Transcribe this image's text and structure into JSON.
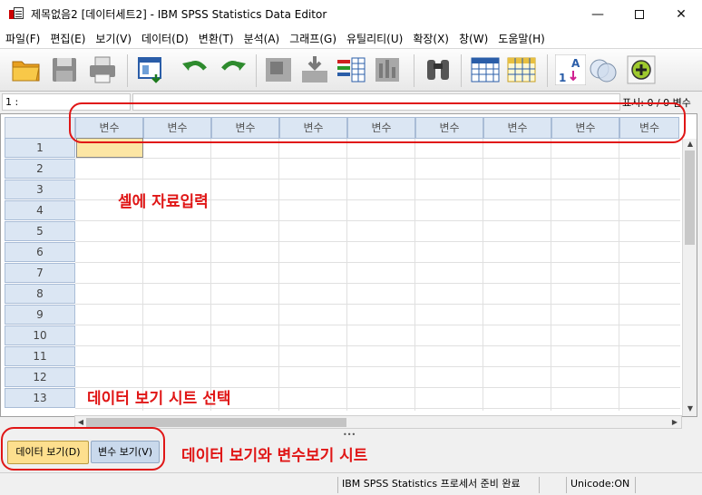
{
  "window": {
    "title": "제목없음2 [데이터세트2] - IBM SPSS Statistics Data Editor",
    "minimize_glyph": "—",
    "close_glyph": "✕"
  },
  "menu": [
    {
      "label": "파일(F)"
    },
    {
      "label": "편집(E)"
    },
    {
      "label": "보기(V)"
    },
    {
      "label": "데이터(D)"
    },
    {
      "label": "변환(T)"
    },
    {
      "label": "분석(A)"
    },
    {
      "label": "그래프(G)"
    },
    {
      "label": "유틸리티(U)"
    },
    {
      "label": "확장(X)"
    },
    {
      "label": "창(W)"
    },
    {
      "label": "도움말(H)"
    }
  ],
  "toolbar": {
    "icons": [
      "open-folder-icon",
      "save-icon",
      "print-icon",
      "dialog-recall-icon",
      "undo-icon",
      "redo-icon",
      "goto-case-icon",
      "goto-variable-icon",
      "variables-icon",
      "run-descriptive-icon",
      "find-icon",
      "insert-cases-icon",
      "insert-variable-icon",
      "value-labels-icon",
      "use-sets-icon",
      "add-icon"
    ]
  },
  "cell_editor": {
    "cell_ref": "1 :",
    "visible_count": "표시: 0 / 0 변수"
  },
  "grid": {
    "column_header": "변수",
    "columns": [
      "변수",
      "변수",
      "변수",
      "변수",
      "변수",
      "변수",
      "변수",
      "변수",
      "변수"
    ],
    "rows": [
      "1",
      "2",
      "3",
      "4",
      "5",
      "6",
      "7",
      "8",
      "9",
      "10",
      "11",
      "12",
      "13"
    ]
  },
  "tabs": {
    "data_view": "데이터 보기(D)",
    "variable_view": "변수 보기(V)"
  },
  "annotations": {
    "cell_input": "셀에 자료입력",
    "data_view_select": "데이터 보기 시트 선택",
    "sheets": "데이터 보기와 변수보기 시트"
  },
  "status": {
    "processor": "IBM SPSS Statistics 프로세서 준비 완료",
    "unicode": "Unicode:ON"
  },
  "colors": {
    "annotation": "#e01616",
    "selected_cell": "#fce6a4",
    "header": "#dbe6f3",
    "data_tab": "#fddf8e"
  }
}
